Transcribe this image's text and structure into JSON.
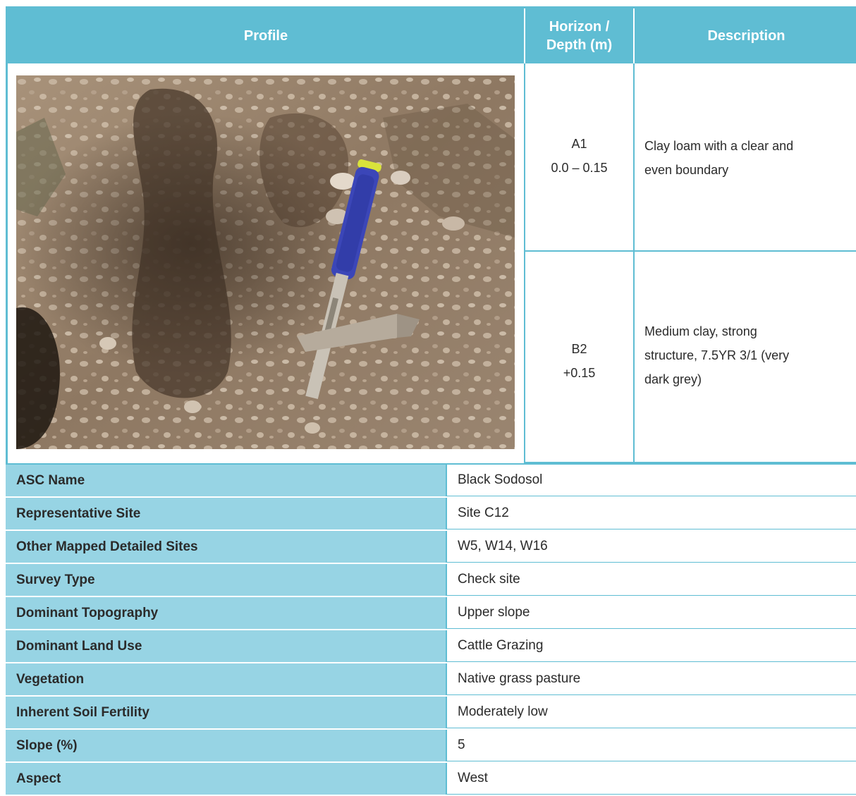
{
  "header": {
    "profile": "Profile",
    "horizon_line1": "Horizon /",
    "horizon_line2": "Depth (m)",
    "description": "Description"
  },
  "horizons": [
    {
      "name": "A1",
      "depth": "0.0 – 0.15",
      "description_line1": "Clay loam with a clear and",
      "description_line2": "even boundary"
    },
    {
      "name": "B2",
      "depth": "+0.15",
      "description_line1": "Medium clay, strong",
      "description_line2": "structure, 7.5YR 3/1 (very",
      "description_line3": "dark grey)"
    }
  ],
  "photo": {
    "subject": "soil profile with rock hammer"
  },
  "attributes": [
    {
      "label": "ASC Name",
      "value": "Black Sodosol"
    },
    {
      "label": "Representative Site",
      "value": "Site C12"
    },
    {
      "label": "Other Mapped Detailed Sites",
      "value": "W5, W14, W16"
    },
    {
      "label": "Survey Type",
      "value": "Check site"
    },
    {
      "label": "Dominant Topography",
      "value": "Upper slope"
    },
    {
      "label": "Dominant Land Use",
      "value": "Cattle Grazing"
    },
    {
      "label": "Vegetation",
      "value": "Native grass pasture"
    },
    {
      "label": "Inherent Soil Fertility",
      "value": "Moderately low"
    },
    {
      "label": "Slope (%)",
      "value": "5"
    },
    {
      "label": "Aspect",
      "value": "West"
    }
  ],
  "colors": {
    "header": "#5fbdd3",
    "label_bg": "#97d4e4"
  }
}
